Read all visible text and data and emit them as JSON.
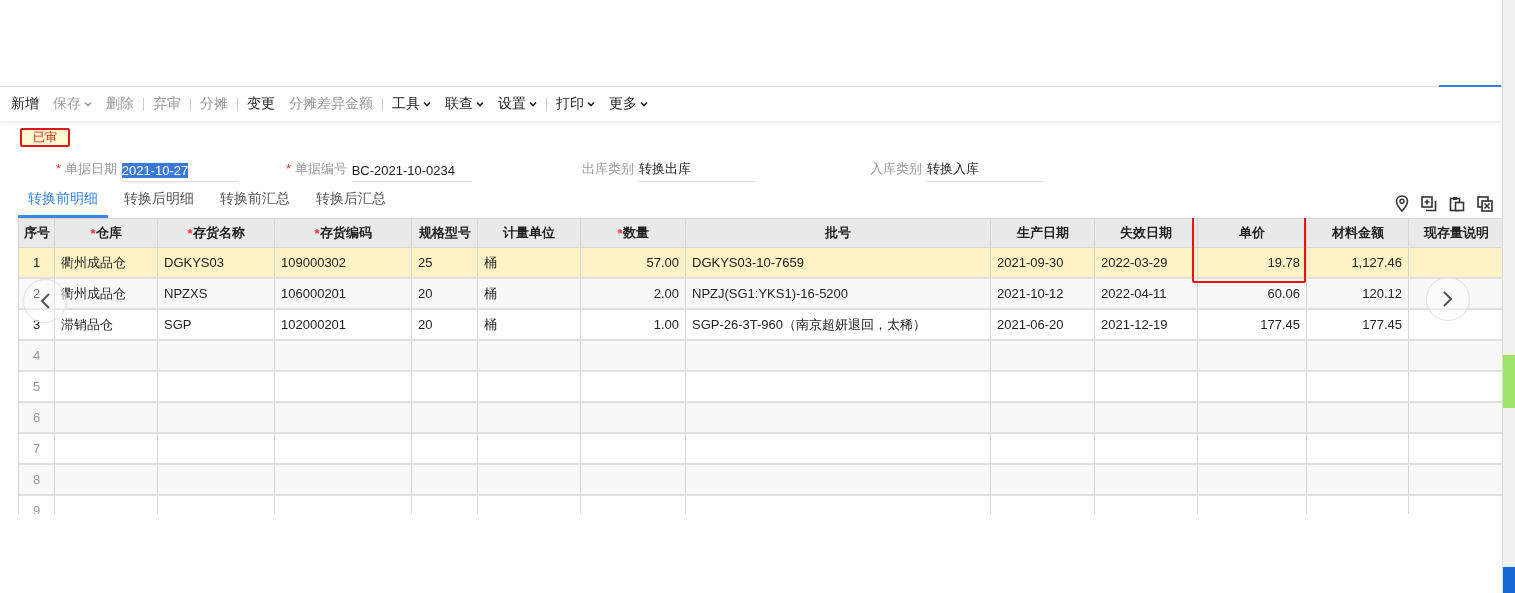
{
  "toolbar": {
    "groups": [
      [
        {
          "label": "新增",
          "disabled": false,
          "dropdown": false
        },
        {
          "label": "保存",
          "disabled": true,
          "dropdown": true
        },
        {
          "label": "删除",
          "disabled": true,
          "dropdown": false
        }
      ],
      [
        {
          "label": "弃审",
          "disabled": true,
          "dropdown": false
        }
      ],
      [
        {
          "label": "分摊",
          "disabled": true,
          "dropdown": false
        }
      ],
      [
        {
          "label": "变更",
          "disabled": false,
          "dropdown": false
        },
        {
          "label": "分摊差异金额",
          "disabled": true,
          "dropdown": false
        }
      ],
      [
        {
          "label": "工具",
          "disabled": false,
          "dropdown": true
        },
        {
          "label": "联查",
          "disabled": false,
          "dropdown": true
        },
        {
          "label": "设置",
          "disabled": false,
          "dropdown": true
        }
      ],
      [
        {
          "label": "打印",
          "disabled": false,
          "dropdown": true
        },
        {
          "label": "更多",
          "disabled": false,
          "dropdown": true
        }
      ]
    ]
  },
  "status_badge": "已审",
  "form_fields": [
    {
      "label": "单据日期",
      "mark": "*",
      "value": "2021-10-27",
      "highlighted": true
    },
    {
      "label": "单据编号",
      "mark": "*",
      "value": "BC-2021-10-0234",
      "highlighted": false
    },
    {
      "label": "出库类别",
      "value": "转换出库",
      "highlighted": false
    },
    {
      "label": "入库类别",
      "value": "转换入库",
      "highlighted": false
    }
  ],
  "tabs": [
    {
      "label": "转换前明细",
      "selected": true
    },
    {
      "label": "转换后明细",
      "selected": false
    },
    {
      "label": "转换前汇总",
      "selected": false
    },
    {
      "label": "转换后汇总",
      "selected": false
    }
  ],
  "table": {
    "columns": [
      {
        "label": "序号",
        "kind": "index"
      },
      {
        "label": "仓库",
        "mark": "*",
        "kind": "text"
      },
      {
        "label": "存货名称",
        "mark": "*",
        "kind": "text"
      },
      {
        "label": "存货编码",
        "mark": "*",
        "kind": "text"
      },
      {
        "label": "规格型号",
        "kind": "text"
      },
      {
        "label": "计量单位",
        "kind": "text"
      },
      {
        "label": "数量",
        "mark": "*",
        "kind": "number"
      },
      {
        "label": "批号",
        "kind": "text"
      },
      {
        "label": "生产日期",
        "kind": "text"
      },
      {
        "label": "失效日期",
        "kind": "text"
      },
      {
        "label": "单价",
        "kind": "number"
      },
      {
        "label": "材料金额",
        "kind": "number"
      },
      {
        "label": "现存量说明",
        "kind": "text"
      }
    ],
    "rows": [
      {
        "index": "1",
        "selected": true,
        "cells": [
          "衢州成品仓",
          "DGKYS03",
          "109000302",
          "25",
          "桶",
          "57.00",
          "DGKYS03-10-7659",
          "2021-09-30",
          "2022-03-29",
          "19.78",
          "1,127.46"
        ]
      },
      {
        "index": "2",
        "selected": false,
        "cells": [
          "衢州成品仓",
          "NPZXS",
          "106000201",
          "20",
          "桶",
          "2.00",
          "NPZJ(SG1:YKS1)-16-5200",
          "2021-10-12",
          "2022-04-11",
          "60.06",
          "120.12"
        ]
      },
      {
        "index": "3",
        "selected": false,
        "cells": [
          "滞销品仓",
          "SGP",
          "102000201",
          "20",
          "桶",
          "1.00",
          "SGP-26-3T-960（南京超妍退回，太稀）",
          "2021-06-20",
          "2021-12-19",
          "177.45",
          "177.45"
        ]
      },
      {
        "index": "4",
        "selected": false
      },
      {
        "index": "5",
        "selected": false
      },
      {
        "index": "6",
        "selected": false
      },
      {
        "index": "7",
        "selected": false
      },
      {
        "index": "8",
        "selected": false
      },
      {
        "index": "9",
        "selected": false
      }
    ]
  }
}
